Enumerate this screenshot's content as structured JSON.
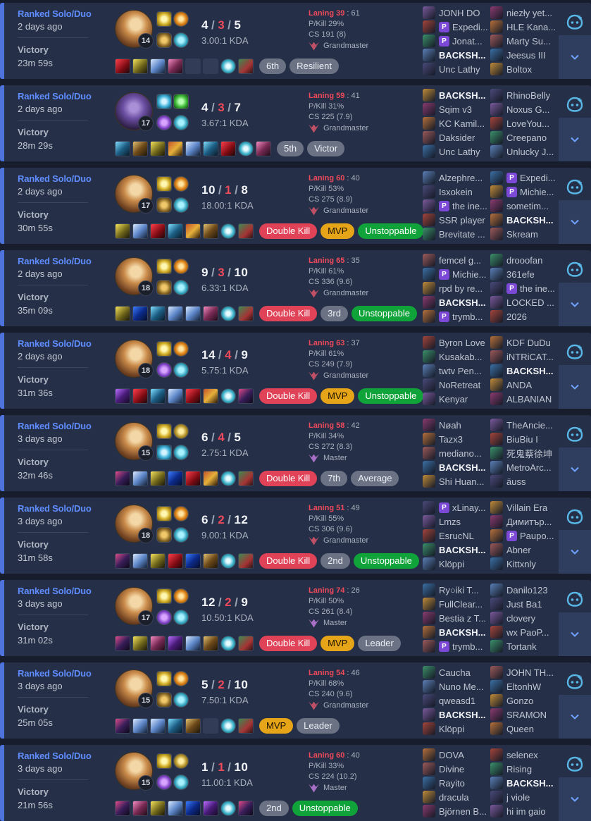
{
  "colors": {
    "win_accent": "#4f73dd",
    "queue_text": "#5f8dff",
    "deaths": "#ef4a5b",
    "badge_multikill": "#e04257",
    "badge_mvp": "#e6a418",
    "badge_placement": "#6a7284",
    "badge_unstoppable": "#0fa33a",
    "card_bg": "#252f47",
    "page_bg": "#171d2c"
  },
  "icons": {
    "spectate": "ghost-face-icon",
    "expand": "chevron-down-icon",
    "premium_badge_letter": "P"
  },
  "matches": [
    {
      "queue": "Ranked Solo/Duo",
      "ago": "2 days ago",
      "result": "Victory",
      "duration": "23m 59s",
      "champion_level": "14",
      "champion_style": "blonde",
      "spells": [
        "flash",
        "ignite"
      ],
      "runes": [
        "keystone",
        "rune3"
      ],
      "kills": "4",
      "deaths": "3",
      "assists": "5",
      "kda": "3.00:1 KDA",
      "items": [
        "c0",
        "c1",
        "c2",
        "c3",
        "empty",
        "empty",
        "trinket",
        "boots"
      ],
      "badges": [
        {
          "text": "6th",
          "kind": "place"
        },
        {
          "text": "Resilient",
          "kind": "place"
        }
      ],
      "laning_label": "Laning",
      "laning_score": "39",
      "laning_opp": "61",
      "pkill": "P/Kill 29%",
      "cs": "CS 191 (8)",
      "tier": "Grandmaster",
      "tier_kind": "gm",
      "blue": [
        {
          "n": "JONH DO"
        },
        {
          "n": "Expedi...",
          "p": true
        },
        {
          "n": "Jonat...",
          "p": true
        },
        {
          "n": "BACKSH...",
          "me": true
        },
        {
          "n": "Unc Lathy"
        }
      ],
      "red": [
        {
          "n": "niezły yet..."
        },
        {
          "n": "HLE Kana..."
        },
        {
          "n": "Marty Su..."
        },
        {
          "n": "Jeesus III"
        },
        {
          "n": "Boltox"
        }
      ]
    },
    {
      "queue": "Ranked Solo/Duo",
      "ago": "2 days ago",
      "result": "Victory",
      "duration": "28m 29s",
      "champion_level": "17",
      "champion_style": "dark",
      "spells": [
        "ghost",
        "barrier"
      ],
      "runes": [
        "rune2",
        "rune3"
      ],
      "kills": "4",
      "deaths": "3",
      "assists": "7",
      "kda": "3.67:1 KDA",
      "items": [
        "c5",
        "c6",
        "c1",
        "c4",
        "c2",
        "c5",
        "c0",
        "trinket",
        "c3"
      ],
      "badges": [
        {
          "text": "5th",
          "kind": "place"
        },
        {
          "text": "Victor",
          "kind": "place"
        }
      ],
      "laning_label": "Laning",
      "laning_score": "59",
      "laning_opp": "41",
      "pkill": "P/Kill 31%",
      "cs": "CS 225 (7.9)",
      "tier": "Grandmaster",
      "tier_kind": "gm",
      "blue": [
        {
          "n": "BACKSH...",
          "me": true
        },
        {
          "n": "Sqim v3"
        },
        {
          "n": "KC Kamil..."
        },
        {
          "n": "Daksider"
        },
        {
          "n": "Unc Lathy"
        }
      ],
      "red": [
        {
          "n": "RhinoBelly"
        },
        {
          "n": "Noxus G..."
        },
        {
          "n": "LoveYou..."
        },
        {
          "n": "Creepano"
        },
        {
          "n": "Unlucky J..."
        }
      ]
    },
    {
      "queue": "Ranked Solo/Duo",
      "ago": "2 days ago",
      "result": "Victory",
      "duration": "30m 55s",
      "champion_level": "17",
      "champion_style": "blonde",
      "spells": [
        "flash",
        "ignite"
      ],
      "runes": [
        "keystone",
        "rune3"
      ],
      "kills": "10",
      "deaths": "1",
      "assists": "8",
      "kda": "18.00:1 KDA",
      "items": [
        "c1",
        "c2",
        "c0",
        "c5",
        "c4",
        "c6",
        "trinket",
        "boots"
      ],
      "badges": [
        {
          "text": "Double Kill",
          "kind": "multi"
        },
        {
          "text": "MVP",
          "kind": "mvp"
        },
        {
          "text": "Unstoppable",
          "kind": "unstoppable"
        }
      ],
      "laning_label": "Laning",
      "laning_score": "60",
      "laning_opp": "40",
      "pkill": "P/Kill 53%",
      "cs": "CS 275 (8.9)",
      "tier": "Grandmaster",
      "tier_kind": "gm",
      "blue": [
        {
          "n": "Alzephre..."
        },
        {
          "n": "Isxokein"
        },
        {
          "n": "the ine...",
          "p": true
        },
        {
          "n": "SSR player"
        },
        {
          "n": "Brevitate ..."
        }
      ],
      "red": [
        {
          "n": "Expedi...",
          "p": true
        },
        {
          "n": "Michie...",
          "p": true
        },
        {
          "n": "sometim..."
        },
        {
          "n": "BACKSH...",
          "me": true
        },
        {
          "n": "Skream"
        }
      ]
    },
    {
      "queue": "Ranked Solo/Duo",
      "ago": "2 days ago",
      "result": "Victory",
      "duration": "35m 09s",
      "champion_level": "18",
      "champion_style": "blonde",
      "spells": [
        "flash",
        "ignite"
      ],
      "runes": [
        "keystone",
        "rune3"
      ],
      "kills": "9",
      "deaths": "3",
      "assists": "10",
      "kda": "6.33:1 KDA",
      "items": [
        "c1",
        "c8",
        "c5",
        "c2",
        "c2",
        "c3",
        "trinket",
        "boots"
      ],
      "badges": [
        {
          "text": "Double Kill",
          "kind": "multi"
        },
        {
          "text": "3rd",
          "kind": "place"
        },
        {
          "text": "Unstoppable",
          "kind": "unstoppable"
        }
      ],
      "laning_label": "Laning",
      "laning_score": "65",
      "laning_opp": "35",
      "pkill": "P/Kill 61%",
      "cs": "CS 336 (9.6)",
      "tier": "Grandmaster",
      "tier_kind": "gm",
      "blue": [
        {
          "n": "femcel g..."
        },
        {
          "n": "Michie...",
          "p": true
        },
        {
          "n": "rpd by re..."
        },
        {
          "n": "BACKSH...",
          "me": true
        },
        {
          "n": "trymb...",
          "p": true
        }
      ],
      "red": [
        {
          "n": "drooofan"
        },
        {
          "n": "361efe"
        },
        {
          "n": "the ine...",
          "p": true
        },
        {
          "n": "LOCKED ..."
        },
        {
          "n": "2026"
        }
      ]
    },
    {
      "queue": "Ranked Solo/Duo",
      "ago": "2 days ago",
      "result": "Victory",
      "duration": "31m 36s",
      "champion_level": "18",
      "champion_style": "blonde",
      "spells": [
        "flash",
        "ignite"
      ],
      "runes": [
        "rune2",
        "rune3"
      ],
      "kills": "14",
      "deaths": "4",
      "assists": "9",
      "kda": "5.75:1 KDA",
      "items": [
        "c7",
        "c0",
        "c5",
        "c2",
        "c0",
        "c4",
        "trinket",
        "c9"
      ],
      "badges": [
        {
          "text": "Double Kill",
          "kind": "multi"
        },
        {
          "text": "MVP",
          "kind": "mvp"
        },
        {
          "text": "Unstoppable",
          "kind": "unstoppable"
        }
      ],
      "laning_label": "Laning",
      "laning_score": "63",
      "laning_opp": "37",
      "pkill": "P/Kill 61%",
      "cs": "CS 249 (7.9)",
      "tier": "Grandmaster",
      "tier_kind": "gm",
      "blue": [
        {
          "n": "Byron Love"
        },
        {
          "n": "Kusakab..."
        },
        {
          "n": "twtv Pen..."
        },
        {
          "n": "NoRetreat"
        },
        {
          "n": "Kenyar"
        }
      ],
      "red": [
        {
          "n": "KDF DuDu"
        },
        {
          "n": "iNTRiCAT..."
        },
        {
          "n": "BACKSH...",
          "me": true
        },
        {
          "n": "ANDA"
        },
        {
          "n": "ALBANIAN"
        }
      ]
    },
    {
      "queue": "Ranked Solo/Duo",
      "ago": "3 days ago",
      "result": "Victory",
      "duration": "32m 46s",
      "champion_level": "15",
      "champion_style": "blonde",
      "spells": [
        "flash",
        "tp"
      ],
      "runes": [
        "ghost",
        "rune3"
      ],
      "kills": "6",
      "deaths": "4",
      "assists": "5",
      "kda": "2.75:1 KDA",
      "items": [
        "c9",
        "c2",
        "c1",
        "c8",
        "c0",
        "c4",
        "trinket",
        "boots"
      ],
      "badges": [
        {
          "text": "Double Kill",
          "kind": "multi"
        },
        {
          "text": "7th",
          "kind": "place"
        },
        {
          "text": "Average",
          "kind": "place"
        }
      ],
      "laning_label": "Laning",
      "laning_score": "58",
      "laning_opp": "42",
      "pkill": "P/Kill 34%",
      "cs": "CS 272 (8.3)",
      "tier": "Master",
      "tier_kind": "master",
      "blue": [
        {
          "n": "Nøah"
        },
        {
          "n": "Tazx3"
        },
        {
          "n": "mediano..."
        },
        {
          "n": "BACKSH...",
          "me": true
        },
        {
          "n": "Shi Huan..."
        }
      ],
      "red": [
        {
          "n": "TheAncie..."
        },
        {
          "n": "BiuBiu I"
        },
        {
          "n": "死鬼蔡徐坤"
        },
        {
          "n": "MetroArc..."
        },
        {
          "n": "äuss"
        }
      ]
    },
    {
      "queue": "Ranked Solo/Duo",
      "ago": "3 days ago",
      "result": "Victory",
      "duration": "31m 58s",
      "champion_level": "18",
      "champion_style": "blonde",
      "spells": [
        "flash",
        "ignite"
      ],
      "runes": [
        "keystone",
        "rune3"
      ],
      "kills": "6",
      "deaths": "2",
      "assists": "12",
      "kda": "9.00:1 KDA",
      "items": [
        "c9",
        "c2",
        "c1",
        "c0",
        "c8",
        "c6",
        "trinket",
        "boots"
      ],
      "badges": [
        {
          "text": "Double Kill",
          "kind": "multi"
        },
        {
          "text": "2nd",
          "kind": "place"
        },
        {
          "text": "Unstoppable",
          "kind": "unstoppable"
        }
      ],
      "laning_label": "Laning",
      "laning_score": "51",
      "laning_opp": "49",
      "pkill": "P/Kill 55%",
      "cs": "CS 306 (9.6)",
      "tier": "Grandmaster",
      "tier_kind": "gm",
      "blue": [
        {
          "n": "xLinay...",
          "p": true
        },
        {
          "n": "Lmzs"
        },
        {
          "n": "EsrucNL"
        },
        {
          "n": "BACKSH...",
          "me": true
        },
        {
          "n": "Klöppi"
        }
      ],
      "red": [
        {
          "n": "Villain Era"
        },
        {
          "n": "Димитър..."
        },
        {
          "n": "Paupo...",
          "p": true
        },
        {
          "n": "Abner"
        },
        {
          "n": "Kittxnly"
        }
      ]
    },
    {
      "queue": "Ranked Solo/Duo",
      "ago": "3 days ago",
      "result": "Victory",
      "duration": "31m 02s",
      "champion_level": "17",
      "champion_style": "blonde",
      "spells": [
        "flash",
        "ignite"
      ],
      "runes": [
        "rune2",
        "rune3"
      ],
      "kills": "12",
      "deaths": "2",
      "assists": "9",
      "kda": "10.50:1 KDA",
      "items": [
        "c9",
        "c1",
        "c3",
        "c7",
        "c2",
        "c6",
        "trinket",
        "boots"
      ],
      "badges": [
        {
          "text": "Double Kill",
          "kind": "multi"
        },
        {
          "text": "MVP",
          "kind": "mvp"
        },
        {
          "text": "Leader",
          "kind": "place"
        }
      ],
      "laning_label": "Laning",
      "laning_score": "74",
      "laning_opp": "26",
      "pkill": "P/Kill 50%",
      "cs": "CS 261 (8.4)",
      "tier": "Master",
      "tier_kind": "master",
      "blue": [
        {
          "n": "Ry○iki T..."
        },
        {
          "n": "FullClear..."
        },
        {
          "n": "Bestia z T..."
        },
        {
          "n": "BACKSH...",
          "me": true
        },
        {
          "n": "trymb...",
          "p": true
        }
      ],
      "red": [
        {
          "n": "Danilo123"
        },
        {
          "n": "Just Ba1"
        },
        {
          "n": "clovery"
        },
        {
          "n": "wx PaoP..."
        },
        {
          "n": "Tortank"
        }
      ]
    },
    {
      "queue": "Ranked Solo/Duo",
      "ago": "3 days ago",
      "result": "Victory",
      "duration": "25m 05s",
      "champion_level": "15",
      "champion_style": "blonde",
      "spells": [
        "flash",
        "ignite"
      ],
      "runes": [
        "keystone",
        "rune3"
      ],
      "kills": "5",
      "deaths": "2",
      "assists": "10",
      "kda": "7.50:1 KDA",
      "items": [
        "c9",
        "c2",
        "c2",
        "c5",
        "c6",
        "empty",
        "trinket",
        "boots"
      ],
      "badges": [
        {
          "text": "MVP",
          "kind": "mvp"
        },
        {
          "text": "Leader",
          "kind": "place"
        }
      ],
      "laning_label": "Laning",
      "laning_score": "54",
      "laning_opp": "46",
      "pkill": "P/Kill 68%",
      "cs": "CS 240 (9.6)",
      "tier": "Grandmaster",
      "tier_kind": "gm",
      "blue": [
        {
          "n": "Caucha"
        },
        {
          "n": "Nuno Me..."
        },
        {
          "n": "qweasd1"
        },
        {
          "n": "BACKSH...",
          "me": true
        },
        {
          "n": "Klöppi"
        }
      ],
      "red": [
        {
          "n": "JOHN TH..."
        },
        {
          "n": "EltonhW"
        },
        {
          "n": "Gonzo"
        },
        {
          "n": "SRAMON"
        },
        {
          "n": "Queen"
        }
      ]
    },
    {
      "queue": "Ranked Solo/Duo",
      "ago": "3 days ago",
      "result": "Victory",
      "duration": "21m 56s",
      "champion_level": "15",
      "champion_style": "blonde",
      "spells": [
        "flash",
        "tp"
      ],
      "runes": [
        "rune2",
        "rune3"
      ],
      "kills": "1",
      "deaths": "1",
      "assists": "10",
      "kda": "11.00:1 KDA",
      "items": [
        "c9",
        "c3",
        "c1",
        "c2",
        "c8",
        "c7",
        "trinket",
        "c9"
      ],
      "badges": [
        {
          "text": "2nd",
          "kind": "place"
        },
        {
          "text": "Unstoppable",
          "kind": "unstoppable"
        }
      ],
      "laning_label": "Laning",
      "laning_score": "60",
      "laning_opp": "40",
      "pkill": "P/Kill 33%",
      "cs": "CS 224 (10.2)",
      "tier": "Master",
      "tier_kind": "master",
      "blue": [
        {
          "n": "DOVA"
        },
        {
          "n": "Divine"
        },
        {
          "n": "Rayito"
        },
        {
          "n": "dracula"
        },
        {
          "n": "Björnen B..."
        }
      ],
      "red": [
        {
          "n": "selenex"
        },
        {
          "n": "Rising"
        },
        {
          "n": "BACKSH...",
          "me": true
        },
        {
          "n": "j viole"
        },
        {
          "n": "hi im gaio"
        }
      ]
    }
  ]
}
